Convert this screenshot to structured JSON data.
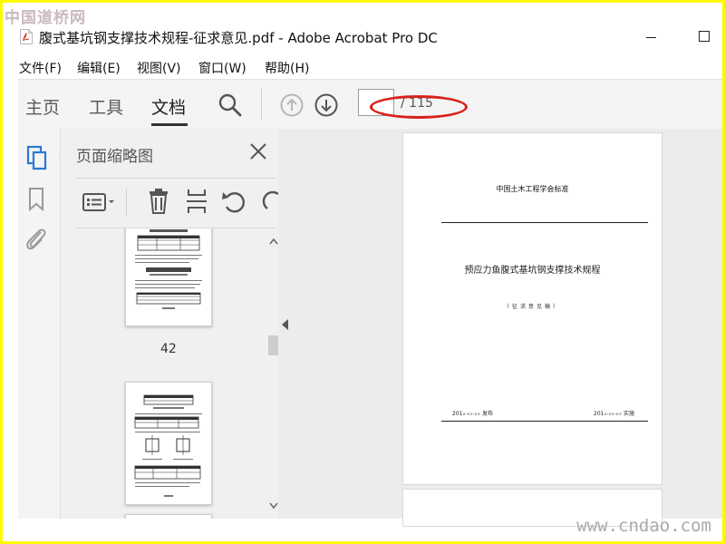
{
  "watermarks": {
    "top": "中国道桥网",
    "bottom": "www.cndao.com"
  },
  "window": {
    "title": "腹式基坑钢支撑技术规程-征求意见.pdf - Adobe Acrobat Pro DC"
  },
  "menu": [
    "文件(F)",
    "编辑(E)",
    "视图(V)",
    "窗口(W)",
    "帮助(H)"
  ],
  "toolbar": {
    "tabs": [
      "主页",
      "工具",
      "文档"
    ],
    "active_tab": "文档",
    "page_current": "",
    "page_total": "/ 115",
    "icons": [
      "search-icon",
      "arrow-up-circle-icon",
      "arrow-down-circle-icon"
    ]
  },
  "nav_icons": [
    "pages-icon",
    "bookmark-icon",
    "paperclip-icon"
  ],
  "thumbnails": {
    "title": "页面缩略图",
    "tools": [
      "options-menu-icon",
      "trash-icon",
      "insert-page-icon",
      "rotate-left-icon",
      "rotate-right-icon"
    ],
    "pages": [
      {
        "label": "42"
      },
      {
        "label": ""
      }
    ]
  },
  "document": {
    "org": "中国土木工程学会标准",
    "title": "预应力鱼腹式基坑钢支撑技术规程",
    "subtitle": "（征求意见稿）",
    "issue_year": "201",
    "issue_placeholder": "×-××-××",
    "issue_label": "发布",
    "impl_year": "201",
    "impl_placeholder": "×-××-××",
    "impl_label": "实施"
  },
  "colors": {
    "highlight": "#d9211b",
    "border": "#fefa00",
    "toolbar_bg": "#f4f4f4",
    "viewer_bg": "#ececec"
  }
}
